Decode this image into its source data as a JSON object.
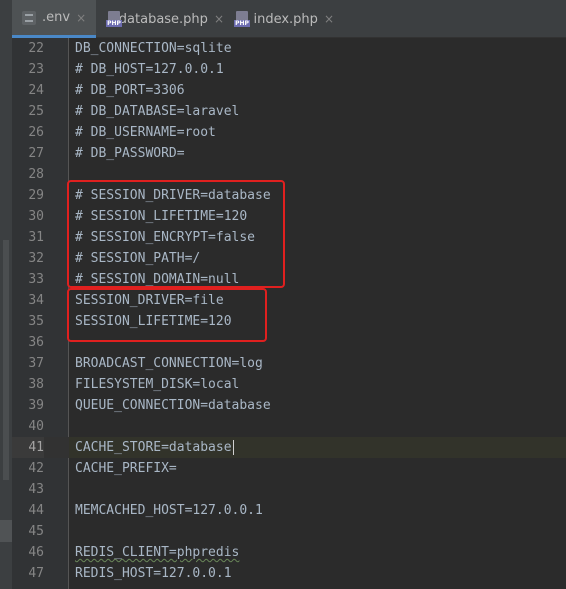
{
  "tabs": [
    {
      "label": ".env",
      "icon": "env-file-icon",
      "active": true
    },
    {
      "label": "database.php",
      "icon": "php-file-icon",
      "active": false
    },
    {
      "label": "index.php",
      "icon": "php-file-icon",
      "active": false
    }
  ],
  "icons": {
    "close": "×",
    "php_badge": "PHP"
  },
  "highlight_color": "#e0201f",
  "lines": [
    {
      "num": "22",
      "text": "DB_CONNECTION=sqlite"
    },
    {
      "num": "23",
      "text": "# DB_HOST=127.0.0.1"
    },
    {
      "num": "24",
      "text": "# DB_PORT=3306"
    },
    {
      "num": "25",
      "text": "# DB_DATABASE=laravel"
    },
    {
      "num": "26",
      "text": "# DB_USERNAME=root"
    },
    {
      "num": "27",
      "text": "# DB_PASSWORD="
    },
    {
      "num": "28",
      "text": ""
    },
    {
      "num": "29",
      "text": "# SESSION_DRIVER=database"
    },
    {
      "num": "30",
      "text": "# SESSION_LIFETIME=120"
    },
    {
      "num": "31",
      "text": "# SESSION_ENCRYPT=false"
    },
    {
      "num": "32",
      "text": "# SESSION_PATH=/"
    },
    {
      "num": "33",
      "text": "# SESSION_DOMAIN=null"
    },
    {
      "num": "34",
      "text": "SESSION_DRIVER=file"
    },
    {
      "num": "35",
      "text": "SESSION_LIFETIME=120"
    },
    {
      "num": "36",
      "text": ""
    },
    {
      "num": "37",
      "text": "BROADCAST_CONNECTION=log"
    },
    {
      "num": "38",
      "text": "FILESYSTEM_DISK=local"
    },
    {
      "num": "39",
      "text": "QUEUE_CONNECTION=database"
    },
    {
      "num": "40",
      "text": ""
    },
    {
      "num": "41",
      "text": "CACHE_STORE=database"
    },
    {
      "num": "42",
      "text": "CACHE_PREFIX="
    },
    {
      "num": "43",
      "text": ""
    },
    {
      "num": "44",
      "text": "MEMCACHED_HOST=127.0.0.1"
    },
    {
      "num": "45",
      "text": ""
    },
    {
      "num": "46",
      "text": "REDIS_CLIENT=phpredis"
    },
    {
      "num": "47",
      "text": "REDIS_HOST=127.0.0.1"
    }
  ]
}
